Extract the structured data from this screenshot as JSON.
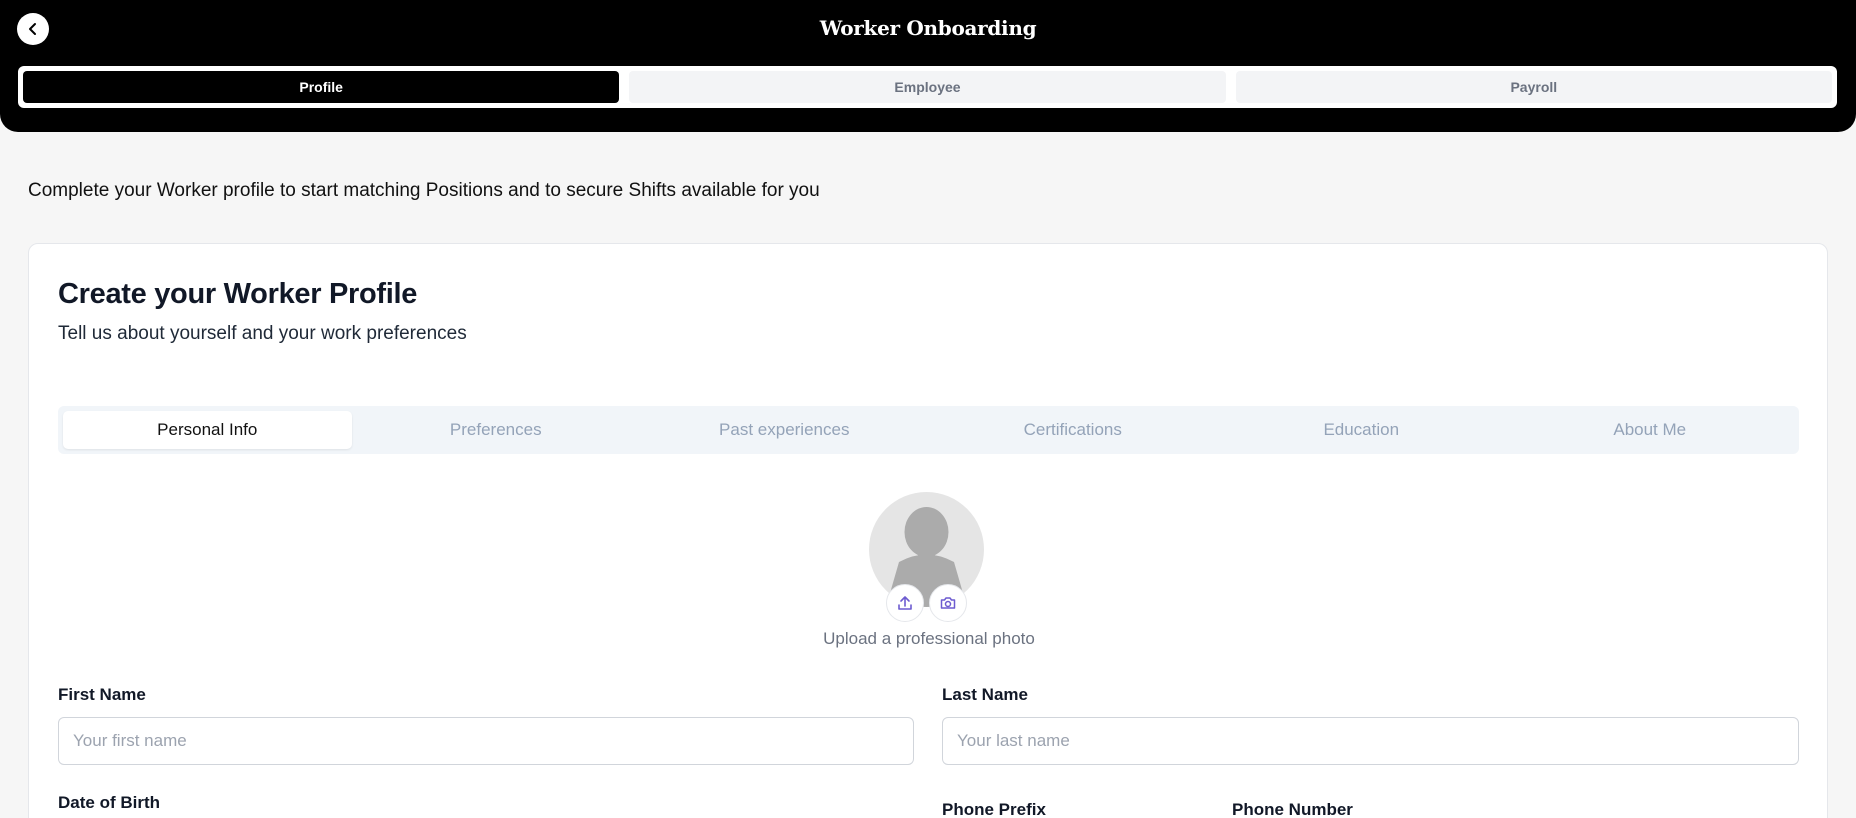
{
  "header": {
    "title": "Worker Onboarding",
    "back_icon": "chevron-left-icon",
    "steps": [
      {
        "label": "Profile",
        "active": true
      },
      {
        "label": "Employee",
        "active": false
      },
      {
        "label": "Payroll",
        "active": false
      }
    ]
  },
  "intro": "Complete your Worker profile to start matching Positions and to secure Shifts available for you",
  "card": {
    "title": "Create your Worker Profile",
    "subtitle": "Tell us about yourself and your work preferences",
    "tabs": [
      {
        "label": "Personal Info",
        "active": true
      },
      {
        "label": "Preferences",
        "active": false
      },
      {
        "label": "Past experiences",
        "active": false
      },
      {
        "label": "Certifications",
        "active": false
      },
      {
        "label": "Education",
        "active": false
      },
      {
        "label": "About Me",
        "active": false
      }
    ],
    "photo": {
      "caption": "Upload a professional photo",
      "upload_icon": "upload-icon",
      "camera_icon": "camera-icon",
      "accent": "#6d5bd0"
    },
    "fields": {
      "first_name": {
        "label": "First Name",
        "placeholder": "Your first name",
        "value": ""
      },
      "last_name": {
        "label": "Last Name",
        "placeholder": "Your last name",
        "value": ""
      },
      "dob": {
        "label": "Date of Birth"
      },
      "phone_prefix": {
        "label": "Phone Prefix"
      },
      "phone_number": {
        "label": "Phone Number"
      }
    }
  }
}
